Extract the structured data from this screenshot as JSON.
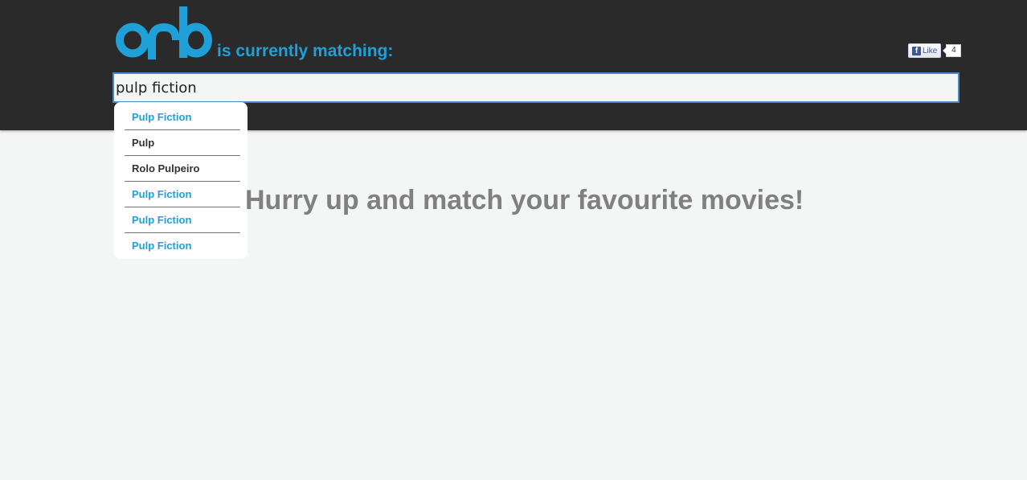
{
  "header": {
    "logo_text": "orb",
    "tagline": "is currently matching:",
    "brand_color": "#1fa0d8",
    "background": "#2a2a2a"
  },
  "facebook": {
    "icon": "f",
    "like_label": "Like",
    "count": "4"
  },
  "search": {
    "value": "pulp fiction",
    "placeholder": ""
  },
  "autocomplete": {
    "items": [
      {
        "label": "Pulp Fiction",
        "color": "#1fa0d8"
      },
      {
        "label": "Pulp",
        "color": "#333333"
      },
      {
        "label": "Rolo Pulpeiro",
        "color": "#333333"
      },
      {
        "label": "Pulp Fiction",
        "color": "#1fa0d8"
      },
      {
        "label": "Pulp Fiction",
        "color": "#1fa0d8"
      },
      {
        "label": "Pulp Fiction",
        "color": "#1fa0d8"
      }
    ]
  },
  "main": {
    "headline": "Hurry up and match your favourite movies!"
  }
}
